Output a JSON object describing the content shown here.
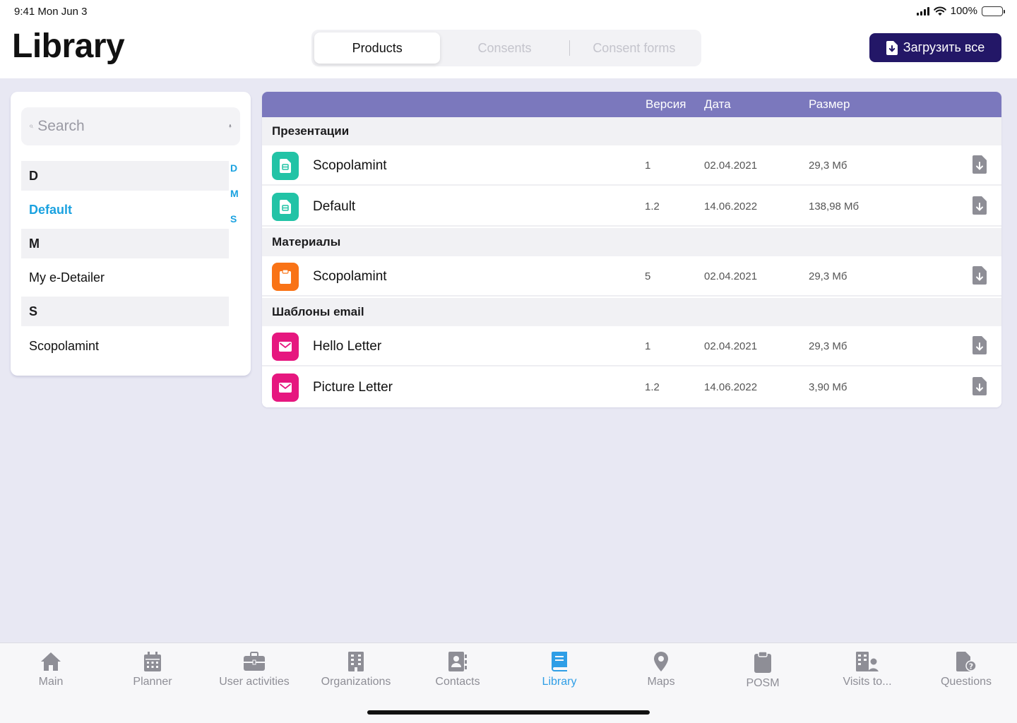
{
  "status": {
    "time": "9:41",
    "date": "Mon Jun 3",
    "battery": "100%"
  },
  "header": {
    "title": "Library",
    "tabs": [
      {
        "label": "Products",
        "active": true
      },
      {
        "label": "Consents",
        "active": false
      },
      {
        "label": "Consent forms",
        "active": false
      }
    ],
    "upload_label": "Загрузить все"
  },
  "sidebar": {
    "search_placeholder": "Search",
    "sections": [
      {
        "letter": "D",
        "items": [
          "Default"
        ]
      },
      {
        "letter": "M",
        "items": [
          "My e-Detailer"
        ]
      },
      {
        "letter": "S",
        "items": [
          "Scopolamint"
        ]
      }
    ],
    "selected_item": "Default",
    "index": [
      "D",
      "M",
      "S"
    ]
  },
  "table": {
    "columns": {
      "version": "Версия",
      "date": "Дата",
      "size": "Размер"
    },
    "groups": [
      {
        "title": "Презентации",
        "rows": [
          {
            "name": "Scopolamint",
            "version": "1",
            "date": "02.04.2021",
            "size": "29,3 Мб",
            "icon": "presentation-icon",
            "color": "#22c3a6"
          },
          {
            "name": "Default",
            "version": "1.2",
            "date": "14.06.2022",
            "size": "138,98 Мб",
            "icon": "presentation-icon",
            "color": "#22c3a6"
          }
        ]
      },
      {
        "title": "Материалы",
        "rows": [
          {
            "name": "Scopolamint",
            "version": "5",
            "date": "02.04.2021",
            "size": "29,3 Мб",
            "icon": "clipboard-icon",
            "color": "#f97316"
          }
        ]
      },
      {
        "title": "Шаблоны email",
        "rows": [
          {
            "name": "Hello Letter",
            "version": "1",
            "date": "02.04.2021",
            "size": "29,3 Мб",
            "icon": "mail-icon",
            "color": "#e6177f"
          },
          {
            "name": "Picture Letter",
            "version": "1.2",
            "date": "14.06.2022",
            "size": "3,90 Мб",
            "icon": "mail-icon",
            "color": "#e6177f"
          }
        ]
      }
    ]
  },
  "tabbar": {
    "items": [
      {
        "label": "Main",
        "icon": "home-icon"
      },
      {
        "label": "Planner",
        "icon": "calendar-icon"
      },
      {
        "label": "User activities",
        "icon": "briefcase-icon"
      },
      {
        "label": "Organizations",
        "icon": "building-icon"
      },
      {
        "label": "Contacts",
        "icon": "contact-book-icon"
      },
      {
        "label": "Library",
        "icon": "book-icon",
        "active": true
      },
      {
        "label": "Maps",
        "icon": "map-pin-icon"
      },
      {
        "label": "POSM",
        "icon": "clipboard-icon"
      },
      {
        "label": "Visits to...",
        "icon": "visits-icon"
      },
      {
        "label": "Questions",
        "icon": "question-doc-icon"
      }
    ]
  },
  "colors": {
    "accent": "#231767",
    "table_header": "#7b78bd",
    "link": "#1ba2e0",
    "tab_active": "#2f9ee6"
  }
}
